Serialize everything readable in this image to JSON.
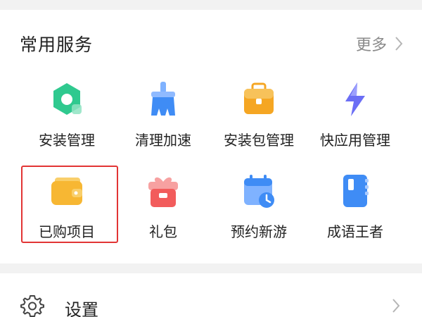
{
  "section": {
    "title": "常用服务",
    "more_label": "更多"
  },
  "services": [
    {
      "label": "安装管理",
      "icon": "install-manager-icon",
      "color": "#2fc98f"
    },
    {
      "label": "清理加速",
      "icon": "broom-clean-icon",
      "color": "#3f8cf5"
    },
    {
      "label": "安装包管理",
      "icon": "package-box-icon",
      "color": "#f5a623"
    },
    {
      "label": "快应用管理",
      "icon": "lightning-icon",
      "color": "#6b6ef5"
    },
    {
      "label": "已购项目",
      "icon": "wallet-icon",
      "color": "#f7b733",
      "highlighted": true
    },
    {
      "label": "礼包",
      "icon": "gift-icon",
      "color": "#f25c5c"
    },
    {
      "label": "预约新游",
      "icon": "calendar-clock-icon",
      "color": "#3f8cf5"
    },
    {
      "label": "成语王者",
      "icon": "notebook-icon",
      "color": "#3f8cf5"
    }
  ],
  "settings": {
    "label": "设置",
    "icon": "gear-icon"
  },
  "colors": {
    "page_bg": "#f2f2f2",
    "card_bg": "#ffffff",
    "highlight": "#e23434"
  }
}
